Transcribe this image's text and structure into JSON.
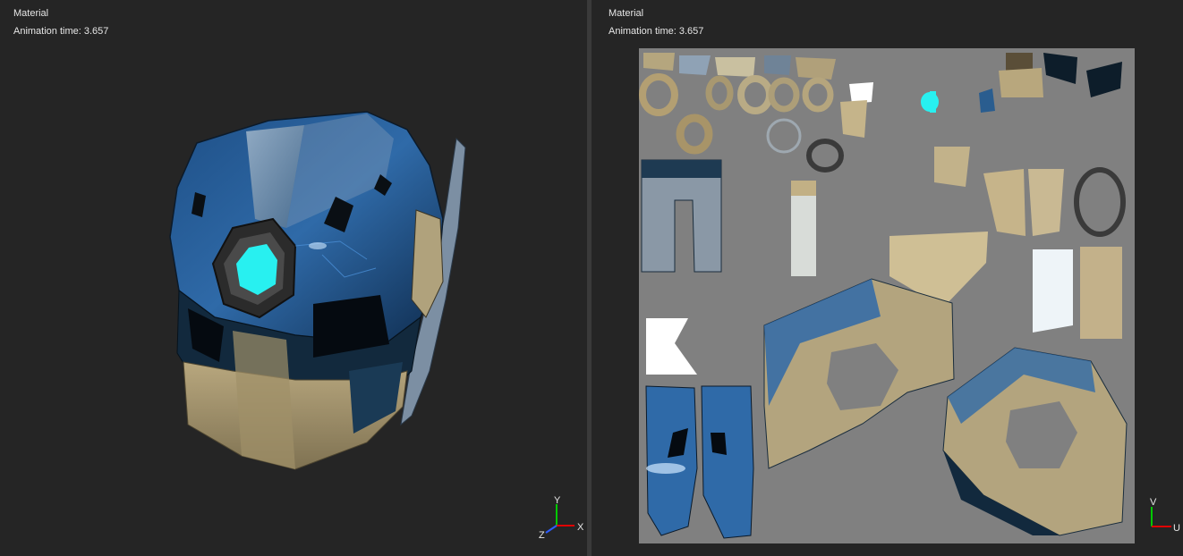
{
  "viewports": {
    "left": {
      "title": "Material",
      "time_label": "Animation time: 3.657",
      "axis_labels": {
        "y": "Y",
        "x": "X",
        "z": "Z"
      }
    },
    "right": {
      "title": "Material",
      "time_label": "Animation time: 3.657",
      "axis_labels": {
        "v": "V",
        "u": "U"
      }
    }
  },
  "colors": {
    "background": "#252525",
    "helmet_blue": "#2d5a8c",
    "helmet_tan": "#a69670",
    "visor_cyan": "#28f0f0",
    "uv_background": "#808080",
    "gizmo_y": "#00c800",
    "gizmo_x": "#e00000",
    "gizmo_z": "#2d5cff"
  },
  "icons": [
    "axis-gizmo-3d-icon",
    "axis-gizmo-uv-icon"
  ]
}
